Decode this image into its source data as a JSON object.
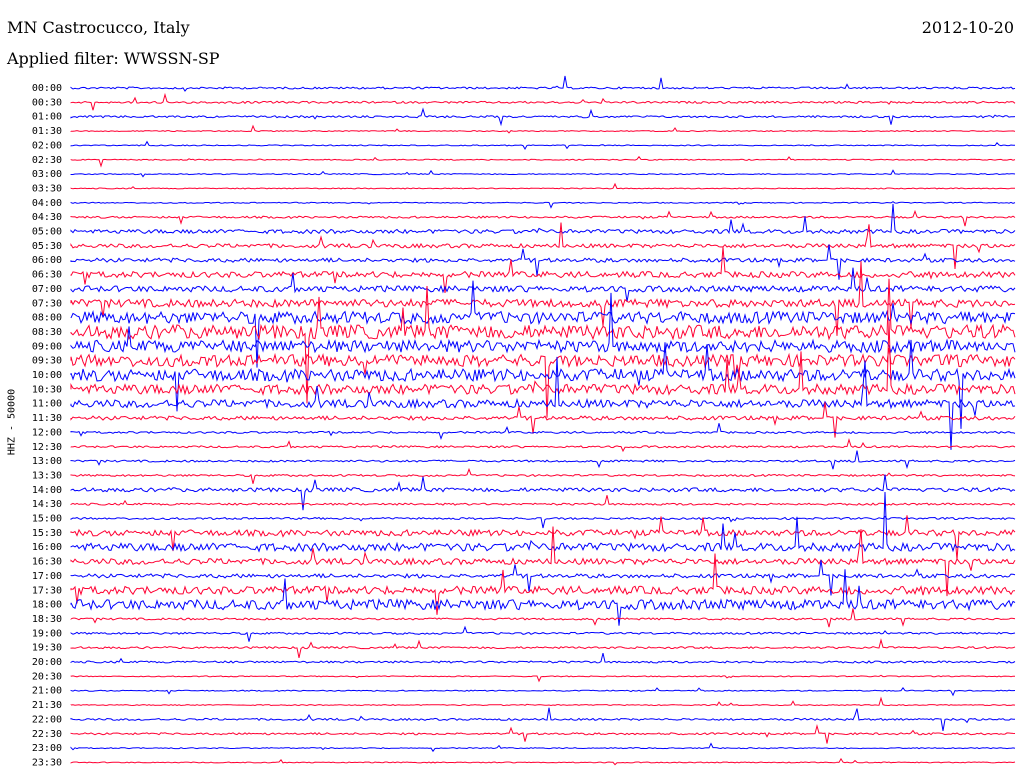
{
  "header": {
    "station": "MN Castrocucco, Italy",
    "date": "2012-10-20",
    "filter": "Applied filter: WWSSN-SP"
  },
  "chart_data": {
    "type": "line",
    "title": "MN Castrocucco, Italy",
    "ylabel": "HHZ - 50000",
    "x": [
      "00:00",
      "00:30",
      "01:00",
      "01:30",
      "02:00",
      "02:30",
      "03:00",
      "03:30",
      "04:00",
      "04:30",
      "05:00",
      "05:30",
      "06:00",
      "06:30",
      "07:00",
      "07:30",
      "08:00",
      "08:30",
      "09:00",
      "09:30",
      "10:00",
      "10:30",
      "11:00",
      "11:30",
      "12:00",
      "12:30",
      "13:00",
      "13:30",
      "14:00",
      "14:30",
      "15:00",
      "15:30",
      "16:00",
      "16:30",
      "17:00",
      "17:30",
      "18:00",
      "18:30",
      "19:00",
      "19:30",
      "20:00",
      "20:30",
      "21:00",
      "21:30",
      "22:00",
      "22:30",
      "23:00",
      "23:30"
    ],
    "series": [
      {
        "values": [
          1,
          1,
          1,
          0.5,
          0.5,
          0.5,
          0.5,
          0.5,
          0.5,
          1,
          2,
          2,
          2,
          3,
          3,
          4,
          6,
          7,
          6,
          6,
          6,
          5,
          4,
          2,
          1,
          1,
          1,
          1,
          2,
          1,
          1,
          3,
          4,
          3,
          2,
          4,
          5,
          1,
          1,
          1,
          1,
          0.5,
          0.5,
          0.5,
          1,
          1,
          0.5,
          0.5
        ]
      }
    ],
    "colors": {
      "even": "#0000ff",
      "odd": "#ff0033"
    }
  }
}
